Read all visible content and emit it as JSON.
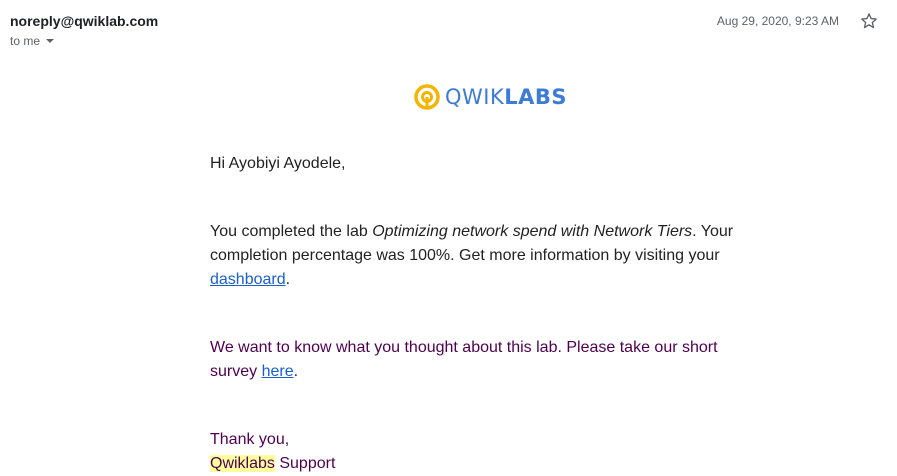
{
  "header": {
    "sender": "noreply@qwiklab.com",
    "recipient_label": "to me",
    "date": "Aug 29, 2020, 9:23 AM"
  },
  "logo": {
    "text_light": "QWIK",
    "text_bold": "LABS",
    "colors": {
      "mark": "#f4b400",
      "text": "#3c7bd6"
    }
  },
  "body": {
    "greeting": "Hi Ayobiyi Ayodele,",
    "completed_prefix": "You completed the lab ",
    "lab_name": "Optimizing network spend with Network Tiers",
    "completed_suffix": ". Your completion percentage was 100%. Get more information by visiting your ",
    "dashboard_link": "dashboard",
    "completed_end": ".",
    "survey_prefix": "We want to know what you thought about this lab. Please take our short survey ",
    "survey_link": "here",
    "survey_end": ".",
    "thanks": "Thank you,",
    "signature_highlight": "Qwiklabs",
    "signature_rest": " Support"
  },
  "colors": {
    "link": "#1a5fcf",
    "quoted_text": "#500050",
    "highlight": "#ffff9d"
  }
}
